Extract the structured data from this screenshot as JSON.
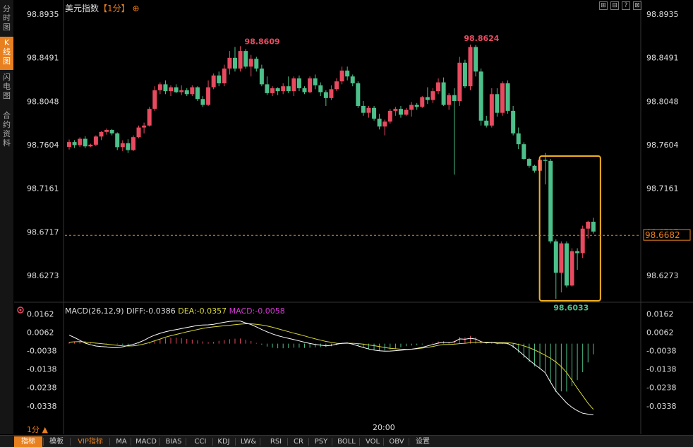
{
  "title": {
    "name": "美元指数",
    "period": "【1分】",
    "icon": "circle-plus-icon"
  },
  "window_buttons": [
    "⊞",
    "⊟",
    "?",
    "⊠",
    "⊡"
  ],
  "side_tabs": [
    {
      "label": "分时图",
      "active": false
    },
    {
      "label": "K线图",
      "active": true
    },
    {
      "label": "闪电图",
      "active": false
    },
    {
      "label": "合约资料",
      "active": false
    }
  ],
  "bottom_tabs": [
    {
      "label": "指标",
      "active": true
    },
    {
      "label": "模板",
      "active": false
    },
    {
      "label": "VIP指标",
      "vip": true
    },
    {
      "label": "MA"
    },
    {
      "label": "MACD"
    },
    {
      "label": "BIAS"
    },
    {
      "label": "CCI"
    },
    {
      "label": "KDJ"
    },
    {
      "label": "LW&"
    },
    {
      "label": "RSI"
    },
    {
      "label": "CR"
    },
    {
      "label": "PSY"
    },
    {
      "label": "BOLL"
    },
    {
      "label": "VOL"
    },
    {
      "label": "OBV"
    },
    {
      "label": "设置"
    }
  ],
  "period_label": "1分 ▲",
  "time_label": "20:00",
  "macd_legend": {
    "name": "MACD(26,12,9)",
    "diff": "DIFF:-0.0386",
    "dea": "DEA:-0.0357",
    "macd": "MACD:-0.0058"
  },
  "colors": {
    "up": "#e84a5f",
    "down": "#4cc08a",
    "dif": "#ffffff",
    "dea": "#d8d83a",
    "highlight": "#f0b020",
    "current": "#e8801f"
  },
  "chart_data": [
    {
      "type": "candlestick",
      "y_ticks": [
        "98.8935",
        "98.8491",
        "98.8048",
        "98.7604",
        "98.7161",
        "98.6717",
        "98.6273"
      ],
      "ylim": [
        98.6,
        98.8935
      ],
      "max_label": "98.8609",
      "max2_label": "98.8624",
      "min_label": "98.6033",
      "current_price": "98.6682",
      "ohlc": [
        [
          98.7582,
          98.7658,
          98.7556,
          98.7632
        ],
        [
          98.7632,
          98.7652,
          98.7571,
          98.76
        ],
        [
          98.76,
          98.768,
          98.758,
          98.7665
        ],
        [
          98.7665,
          98.769,
          98.757,
          98.7588
        ],
        [
          98.7588,
          98.7615,
          98.758,
          98.7605
        ],
        [
          98.7605,
          98.77,
          98.759,
          98.7688
        ],
        [
          98.7688,
          98.7742,
          98.7652,
          98.7735
        ],
        [
          98.7735,
          98.777,
          98.7708,
          98.7755
        ],
        [
          98.7755,
          98.7765,
          98.77,
          98.772
        ],
        [
          98.772,
          98.773,
          98.755,
          98.758
        ],
        [
          98.758,
          98.765,
          98.754,
          98.762
        ],
        [
          98.762,
          98.766,
          98.752,
          98.755
        ],
        [
          98.755,
          98.77,
          98.754,
          98.7682
        ],
        [
          98.7682,
          98.78,
          98.767,
          98.778
        ],
        [
          98.778,
          98.783,
          98.772,
          98.78
        ],
        [
          98.78,
          98.799,
          98.779,
          98.797
        ],
        [
          98.797,
          98.82,
          98.795,
          98.816
        ],
        [
          98.816,
          98.824,
          98.812,
          98.822
        ],
        [
          98.822,
          98.826,
          98.812,
          98.815
        ],
        [
          98.815,
          98.821,
          98.81,
          98.819
        ],
        [
          98.819,
          98.822,
          98.813,
          98.814
        ],
        [
          98.814,
          98.821,
          98.811,
          98.816
        ],
        [
          98.816,
          98.818,
          98.81,
          98.812
        ],
        [
          98.812,
          98.821,
          98.81,
          98.819
        ],
        [
          98.819,
          98.82,
          98.805,
          98.807
        ],
        [
          98.807,
          98.81,
          98.799,
          98.801
        ],
        [
          98.801,
          98.826,
          98.8,
          98.819
        ],
        [
          98.819,
          98.833,
          98.817,
          98.831
        ],
        [
          98.831,
          98.835,
          98.82,
          98.823
        ],
        [
          98.823,
          98.842,
          98.82,
          98.838
        ],
        [
          98.838,
          98.856,
          98.832,
          98.849
        ],
        [
          98.849,
          98.86,
          98.835,
          98.838
        ],
        [
          98.838,
          98.8609,
          98.835,
          98.856
        ],
        [
          98.856,
          98.858,
          98.838,
          98.84
        ],
        [
          98.84,
          98.852,
          98.83,
          98.848
        ],
        [
          98.848,
          98.85,
          98.835,
          98.838
        ],
        [
          98.838,
          98.842,
          98.82,
          98.822
        ],
        [
          98.822,
          98.83,
          98.811,
          98.813
        ],
        [
          98.813,
          98.82,
          98.81,
          98.818
        ],
        [
          98.818,
          98.819,
          98.811,
          98.815
        ],
        [
          98.815,
          98.823,
          98.812,
          98.82
        ],
        [
          98.82,
          98.83,
          98.813,
          98.815
        ],
        [
          98.815,
          98.83,
          98.81,
          98.828
        ],
        [
          98.828,
          98.831,
          98.815,
          98.818
        ],
        [
          98.818,
          98.82,
          98.812,
          98.814
        ],
        [
          98.814,
          98.83,
          98.813,
          98.828
        ],
        [
          98.828,
          98.832,
          98.817,
          98.821
        ],
        [
          98.821,
          98.824,
          98.81,
          98.814
        ],
        [
          98.814,
          98.816,
          98.8,
          98.808
        ],
        [
          98.808,
          98.821,
          98.806,
          98.817
        ],
        [
          98.817,
          98.828,
          98.815,
          98.825
        ],
        [
          98.825,
          98.84,
          98.822,
          98.836
        ],
        [
          98.836,
          98.84,
          98.826,
          98.83
        ],
        [
          98.83,
          98.832,
          98.82,
          98.823
        ],
        [
          98.823,
          98.825,
          98.798,
          98.8
        ],
        [
          98.8,
          98.805,
          98.79,
          98.793
        ],
        [
          98.793,
          98.8,
          98.788,
          98.798
        ],
        [
          98.798,
          98.8,
          98.785,
          98.787
        ],
        [
          98.787,
          98.792,
          98.776,
          98.779
        ],
        [
          98.779,
          98.786,
          98.77,
          98.784
        ],
        [
          98.784,
          98.797,
          98.782,
          98.795
        ],
        [
          98.795,
          98.799,
          98.79,
          98.797
        ],
        [
          98.797,
          98.8,
          98.788,
          98.791
        ],
        [
          98.791,
          98.798,
          98.79,
          98.796
        ],
        [
          98.796,
          98.804,
          98.789,
          98.801
        ],
        [
          98.801,
          98.803,
          98.796,
          98.799
        ],
        [
          98.799,
          98.81,
          98.798,
          98.809
        ],
        [
          98.809,
          98.819,
          98.802,
          98.806
        ],
        [
          98.806,
          98.818,
          98.803,
          98.815
        ],
        [
          98.815,
          98.828,
          98.812,
          98.824
        ],
        [
          98.824,
          98.829,
          98.8,
          98.801
        ],
        [
          98.801,
          98.813,
          98.796,
          98.811
        ],
        [
          98.811,
          98.818,
          98.73,
          98.805
        ],
        [
          98.805,
          98.85,
          98.8,
          98.844
        ],
        [
          98.844,
          98.847,
          98.818,
          98.82
        ],
        [
          98.82,
          98.8624,
          98.816,
          98.86
        ],
        [
          98.86,
          98.862,
          98.83,
          98.835
        ],
        [
          98.835,
          98.838,
          98.78,
          98.785
        ],
        [
          98.785,
          98.79,
          98.778,
          98.78
        ],
        [
          98.78,
          98.818,
          98.778,
          98.812
        ],
        [
          98.812,
          98.818,
          98.789,
          98.793
        ],
        [
          98.793,
          98.825,
          98.79,
          98.823
        ],
        [
          98.823,
          98.826,
          98.792,
          98.795
        ],
        [
          98.795,
          98.8,
          98.77,
          98.772
        ],
        [
          98.772,
          98.778,
          98.756,
          98.761
        ],
        [
          98.761,
          98.763,
          98.745,
          98.746
        ],
        [
          98.746,
          98.747,
          98.737,
          98.739
        ],
        [
          98.739,
          98.74,
          98.732,
          98.734
        ],
        [
          98.734,
          98.747,
          98.73,
          98.745
        ],
        [
          98.745,
          98.752,
          98.72,
          98.744
        ],
        [
          98.744,
          98.746,
          98.66,
          98.662
        ],
        [
          98.662,
          98.664,
          98.6033,
          98.63
        ],
        [
          98.63,
          98.662,
          98.61,
          98.66
        ],
        [
          98.66,
          98.662,
          98.615,
          98.617
        ],
        [
          98.617,
          98.655,
          98.616,
          98.652
        ],
        [
          98.652,
          98.655,
          98.633,
          98.65
        ],
        [
          98.65,
          98.678,
          98.645,
          98.675
        ],
        [
          98.675,
          98.683,
          98.665,
          98.682
        ],
        [
          98.682,
          98.686,
          98.67,
          98.672
        ]
      ]
    },
    {
      "type": "bar+line",
      "name": "MACD(26,12,9)",
      "y_ticks": [
        "0.0162",
        "0.0062",
        "-0.0038",
        "-0.0138",
        "-0.0238",
        "-0.0338"
      ],
      "ylim": [
        -0.045,
        0.0175
      ],
      "macd": [
        0.001,
        0.0012,
        0.0013,
        0.0011,
        0.0008,
        0.0005,
        0.0003,
        0.0002,
        0.0,
        -0.0003,
        -0.0006,
        -0.0007,
        -0.0005,
        -0.0002,
        0.0002,
        0.0007,
        0.0014,
        0.0022,
        0.0029,
        0.0032,
        0.0033,
        0.003,
        0.0026,
        0.0022,
        0.0018,
        0.0012,
        0.0008,
        0.001,
        0.0015,
        0.0019,
        0.0024,
        0.0027,
        0.0028,
        0.0021,
        0.0014,
        0.0004,
        -0.0006,
        -0.0016,
        -0.0022,
        -0.0025,
        -0.0025,
        -0.0024,
        -0.0022,
        -0.0022,
        -0.0023,
        -0.0022,
        -0.002,
        -0.0019,
        -0.0018,
        -0.0014,
        -0.0008,
        -0.0002,
        0.0002,
        -0.0004,
        -0.0013,
        -0.0022,
        -0.0029,
        -0.0036,
        -0.004,
        -0.0037,
        -0.0032,
        -0.0026,
        -0.002,
        -0.0014,
        -0.001,
        -0.0008,
        -0.0004,
        0.0,
        0.0005,
        0.0012,
        0.0013,
        0.0009,
        0.0016,
        0.0037,
        0.0034,
        0.0042,
        0.0034,
        0.0015,
        0.0002,
        0.0005,
        -0.0003,
        -0.0002,
        -0.0004,
        -0.0023,
        -0.0049,
        -0.0077,
        -0.0101,
        -0.0123,
        -0.0138,
        -0.0153,
        -0.0212,
        -0.0262,
        -0.0259,
        -0.026,
        -0.0231,
        -0.0198,
        -0.0155,
        -0.0102,
        -0.0058
      ],
      "dif": [
        0.0046,
        0.0033,
        0.0018,
        0.0003,
        -0.0006,
        -0.0013,
        -0.0016,
        -0.0018,
        -0.0022,
        -0.0022,
        -0.0018,
        -0.001,
        -0.0004,
        0.0006,
        0.0018,
        0.0034,
        0.0046,
        0.0056,
        0.0064,
        0.0071,
        0.0076,
        0.0082,
        0.0088,
        0.0093,
        0.0099,
        0.0101,
        0.0102,
        0.0105,
        0.0111,
        0.0116,
        0.0121,
        0.0123,
        0.0123,
        0.0112,
        0.0104,
        0.0091,
        0.0077,
        0.0064,
        0.0053,
        0.0043,
        0.0036,
        0.0029,
        0.0022,
        0.0015,
        0.0008,
        0.0001,
        -0.0004,
        -0.0008,
        -0.0012,
        -0.0009,
        -0.0003,
        0.0002,
        0.0004,
        -0.0003,
        -0.0012,
        -0.0021,
        -0.0029,
        -0.0035,
        -0.0039,
        -0.0041,
        -0.004,
        -0.0038,
        -0.0036,
        -0.0033,
        -0.003,
        -0.0026,
        -0.002,
        -0.0012,
        -0.0005,
        0.0003,
        0.0008,
        0.0005,
        0.001,
        0.0026,
        0.0024,
        0.0029,
        0.0025,
        0.0011,
        0.0004,
        0.0007,
        0.0002,
        0.0003,
        0.0001,
        -0.0015,
        -0.0038,
        -0.0064,
        -0.0089,
        -0.0113,
        -0.0134,
        -0.0158,
        -0.021,
        -0.0258,
        -0.029,
        -0.0322,
        -0.0346,
        -0.0364,
        -0.0378,
        -0.0383,
        -0.0386
      ],
      "dea": [
        0.0008,
        0.001,
        0.0011,
        0.0009,
        0.0006,
        0.0003,
        0.0,
        -0.0003,
        -0.0006,
        -0.0009,
        -0.0012,
        -0.0013,
        -0.0012,
        -0.0008,
        -0.0002,
        0.0006,
        0.0016,
        0.0025,
        0.0035,
        0.0043,
        0.005,
        0.0057,
        0.0064,
        0.007,
        0.0077,
        0.0083,
        0.0088,
        0.0091,
        0.0094,
        0.0097,
        0.01,
        0.0103,
        0.0106,
        0.0108,
        0.0108,
        0.0105,
        0.0101,
        0.0096,
        0.0089,
        0.0081,
        0.0073,
        0.0065,
        0.0057,
        0.005,
        0.0042,
        0.0034,
        0.0026,
        0.0019,
        0.0012,
        0.0007,
        0.0002,
        0.0001,
        0.0002,
        0.0002,
        0.0,
        -0.0003,
        -0.0007,
        -0.0011,
        -0.0016,
        -0.0021,
        -0.0025,
        -0.0028,
        -0.003,
        -0.0031,
        -0.003,
        -0.0028,
        -0.0024,
        -0.002,
        -0.0015,
        -0.0009,
        -0.0005,
        -0.0004,
        -0.0003,
        0.0,
        0.0002,
        0.0005,
        0.0008,
        0.0008,
        0.0008,
        0.0007,
        0.0006,
        0.0005,
        0.0005,
        0.0002,
        -0.0004,
        -0.0012,
        -0.0022,
        -0.0034,
        -0.0048,
        -0.0063,
        -0.008,
        -0.01,
        -0.0125,
        -0.0157,
        -0.0199,
        -0.0242,
        -0.0283,
        -0.0324,
        -0.0357
      ]
    }
  ]
}
